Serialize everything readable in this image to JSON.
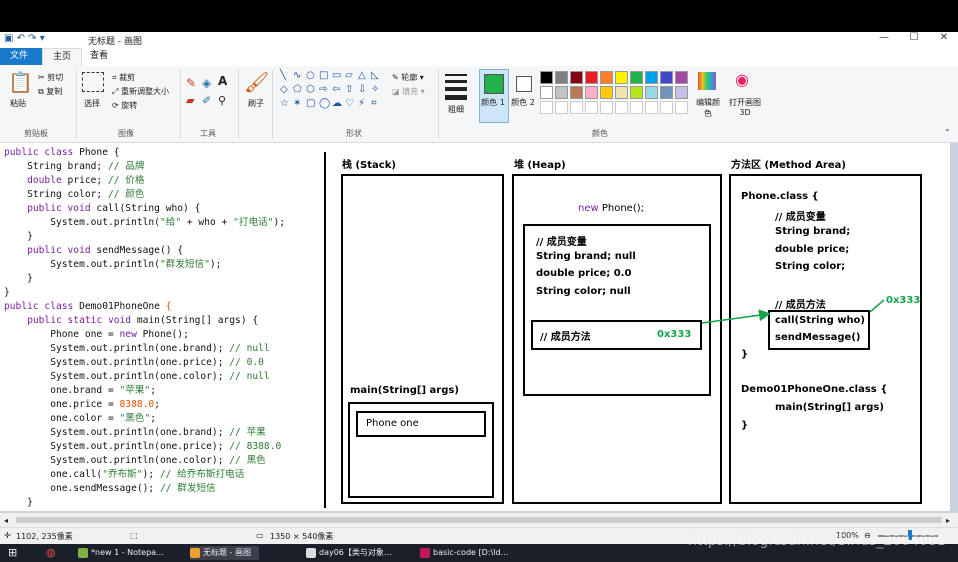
{
  "window": {
    "title": "无标题 - 画图",
    "controls": [
      "—",
      "☐",
      "✕"
    ]
  },
  "tabs": [
    "文件",
    "主页",
    "查看"
  ],
  "ribbon": {
    "clipboard": {
      "paste": "粘贴",
      "cut": "剪切",
      "copy": "复制",
      "group": "剪贴板"
    },
    "image": {
      "select": "选择",
      "crop": "裁剪",
      "resize": "重新调整大小",
      "rotate": "旋转",
      "group": "图像"
    },
    "tools": {
      "group": "工具"
    },
    "brushes": {
      "label": "刷子"
    },
    "shapes": {
      "outline": "轮廓",
      "fill": "填充",
      "group": "形状"
    },
    "size": {
      "label": "粗细"
    },
    "colors": {
      "color1": "颜色 1",
      "color2": "颜色 2",
      "edit": "编辑颜色",
      "paint3d": "打开画图 3D",
      "group": "颜色",
      "palette_row1": [
        "#000000",
        "#7f7f7f",
        "#880015",
        "#ed1c24",
        "#ff7f27",
        "#fff200",
        "#22b14c",
        "#00a2e8",
        "#3f48cc",
        "#a349a4"
      ],
      "palette_row2": [
        "#ffffff",
        "#c3c3c3",
        "#b97a57",
        "#ffaec9",
        "#ffc90e",
        "#efe4b0",
        "#b5e61d",
        "#99d9ea",
        "#7092be",
        "#c8bfe7"
      ],
      "primary": "#22b14c"
    }
  },
  "code_lines": [
    [
      [
        "kw",
        "public class "
      ],
      [
        "pl",
        "Phone {"
      ]
    ],
    [
      [
        "pl",
        "    String brand; "
      ],
      [
        "cm",
        "// 品牌"
      ]
    ],
    [
      [
        "kw",
        "    double "
      ],
      [
        "pl",
        "price; "
      ],
      [
        "cm",
        "// 价格"
      ]
    ],
    [
      [
        "pl",
        "    String color; "
      ],
      [
        "cm",
        "// 颜色"
      ]
    ],
    [
      [
        "kw",
        "    public void "
      ],
      [
        "pl",
        "call(String who) {"
      ]
    ],
    [
      [
        "pl",
        "        System.out.println("
      ],
      [
        "str",
        "\"给\""
      ],
      [
        "pl",
        " + who + "
      ],
      [
        "str",
        "\"打电话\""
      ],
      [
        "pl",
        ");"
      ]
    ],
    [
      [
        "pl",
        "    }"
      ]
    ],
    [
      [
        "kw",
        "    public void "
      ],
      [
        "pl",
        "sendMessage() {"
      ]
    ],
    [
      [
        "pl",
        "        System.out.println("
      ],
      [
        "str",
        "\"群发短信\""
      ],
      [
        "pl",
        ");"
      ]
    ],
    [
      [
        "pl",
        "    }"
      ]
    ],
    [
      [
        "pl",
        "}"
      ]
    ],
    [
      [
        "kw",
        "public class "
      ],
      [
        "pl",
        "Demo01PhoneOne "
      ],
      [
        "num",
        "{"
      ]
    ],
    [
      [
        "kw",
        "    public static void "
      ],
      [
        "pl",
        "main(String[] args) {"
      ]
    ],
    [
      [
        "pl",
        "        Phone one = "
      ],
      [
        "kw",
        "new "
      ],
      [
        "pl",
        "Phone();"
      ]
    ],
    [
      [
        "pl",
        "        System.out.println(one.brand); "
      ],
      [
        "cm",
        "// null"
      ]
    ],
    [
      [
        "pl",
        "        System.out.println(one.price); "
      ],
      [
        "cm",
        "// 0.0"
      ]
    ],
    [
      [
        "pl",
        "        System.out.println(one.color); "
      ],
      [
        "cm",
        "// null"
      ]
    ],
    [
      [
        "pl",
        "        one.brand = "
      ],
      [
        "str",
        "\"苹果\""
      ],
      [
        "pl",
        ";"
      ]
    ],
    [
      [
        "pl",
        "        one.price = "
      ],
      [
        "num",
        "8388.0"
      ],
      [
        "pl",
        ";"
      ]
    ],
    [
      [
        "pl",
        "        one.color = "
      ],
      [
        "str",
        "\"黑色\""
      ],
      [
        "pl",
        ";"
      ]
    ],
    [
      [
        "pl",
        "        System.out.println(one.brand); "
      ],
      [
        "cm",
        "// 苹果"
      ]
    ],
    [
      [
        "pl",
        "        System.out.println(one.price); "
      ],
      [
        "cm",
        "// 8388.0"
      ]
    ],
    [
      [
        "pl",
        "        System.out.println(one.color); "
      ],
      [
        "cm",
        "// 黑色"
      ]
    ],
    [
      [
        "pl",
        "        one.call("
      ],
      [
        "str",
        "\"乔布斯\""
      ],
      [
        "pl",
        "); "
      ],
      [
        "cm",
        "// 给乔布斯打电话"
      ]
    ],
    [
      [
        "pl",
        "        one.sendMessage(); "
      ],
      [
        "cm",
        "// 群发短信"
      ]
    ],
    [
      [
        "pl",
        "    }"
      ]
    ]
  ],
  "diagram": {
    "stack_title": "栈 (Stack)",
    "heap_title": "堆 (Heap)",
    "method_title": "方法区 (Method Area)",
    "main_frame": "main(String[] args)",
    "phone_var": "Phone  one",
    "new_phone_kw": "new",
    "new_phone_rest": " Phone();",
    "heap_member_vars": "// 成员变量",
    "heap_brand": "String brand;   null",
    "heap_price": "double price;   0.0",
    "heap_color": "String color;    null",
    "heap_member_methods": "// 成员方法",
    "heap_addr": "0x333",
    "phone_class": "Phone.class {",
    "ma_member_vars": "// 成员变量",
    "ma_brand": "String brand;",
    "ma_price": "double price;",
    "ma_color": "String color;",
    "ma_member_methods": "// 成员方法",
    "ma_call": "call(String who)",
    "ma_send": "sendMessage()",
    "ma_close1": "}",
    "ma_addr": "0x333",
    "demo_class": "Demo01PhoneOne.class {",
    "demo_main": "main(String[] args)",
    "ma_close2": "}"
  },
  "status": {
    "cursor": "1102, 235像素",
    "size": "1350 × 540像素",
    "zoom": "100%"
  },
  "taskbar": {
    "items": [
      "*new 1 - Notepa...",
      "无标题 - 画图",
      "day06【类与对象...",
      "basic-code [D:\\Id..."
    ]
  },
  "watermark": "https://blog.csdn.net/Sirius_2004081"
}
